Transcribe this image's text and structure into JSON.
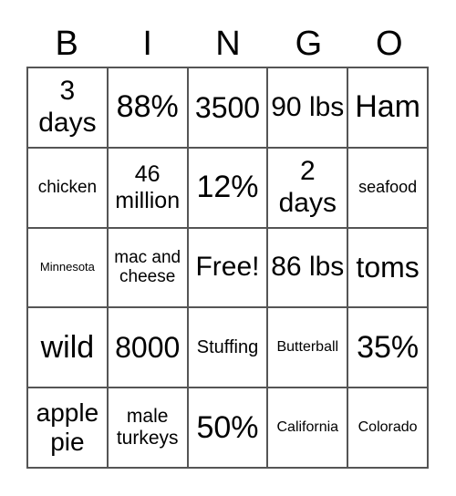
{
  "header": [
    "B",
    "I",
    "N",
    "G",
    "O"
  ],
  "cells": [
    {
      "text": "3 days",
      "size": 30
    },
    {
      "text": "88%",
      "size": 34
    },
    {
      "text": "3500",
      "size": 32
    },
    {
      "text": "90 lbs",
      "size": 30
    },
    {
      "text": "Ham",
      "size": 34
    },
    {
      "text": "chicken",
      "size": 19
    },
    {
      "text": "46 million",
      "size": 25
    },
    {
      "text": "12%",
      "size": 34
    },
    {
      "text": "2 days",
      "size": 30
    },
    {
      "text": "seafood",
      "size": 18
    },
    {
      "text": "Minnesota",
      "size": 13
    },
    {
      "text": "mac and cheese",
      "size": 19
    },
    {
      "text": "Free!",
      "size": 30
    },
    {
      "text": "86 lbs",
      "size": 30
    },
    {
      "text": "toms",
      "size": 32
    },
    {
      "text": "wild",
      "size": 34
    },
    {
      "text": "8000",
      "size": 32
    },
    {
      "text": "Stuffing",
      "size": 20
    },
    {
      "text": "Butterball",
      "size": 16
    },
    {
      "text": "35%",
      "size": 34
    },
    {
      "text": "apple pie",
      "size": 28
    },
    {
      "text": "male turkeys",
      "size": 21
    },
    {
      "text": "50%",
      "size": 34
    },
    {
      "text": "California",
      "size": 16
    },
    {
      "text": "Colorado",
      "size": 16
    }
  ]
}
